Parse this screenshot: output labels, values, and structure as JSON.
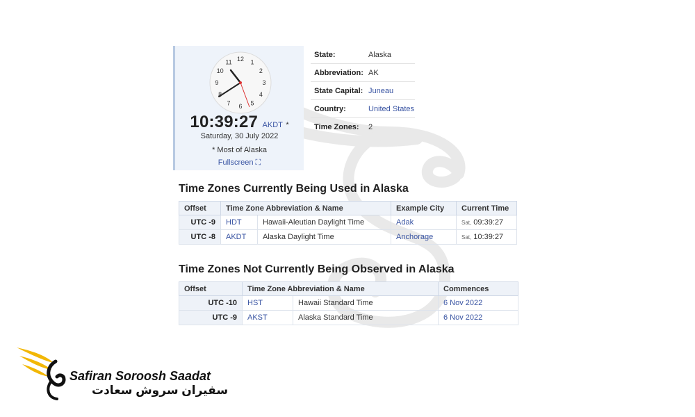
{
  "clock": {
    "numbers": [
      "12",
      "1",
      "2",
      "3",
      "4",
      "5",
      "6",
      "7",
      "8",
      "9",
      "10",
      "11"
    ],
    "time": "10:39:27",
    "tz": "AKDT",
    "star": "*",
    "date": "Saturday, 30 July 2022",
    "note": "* Most of Alaska",
    "fullscreen": "Fullscreen ⛶"
  },
  "info": [
    {
      "k": "State:",
      "v": "Alaska",
      "link": false
    },
    {
      "k": "Abbreviation:",
      "v": "AK",
      "link": false
    },
    {
      "k": "State Capital:",
      "v": "Juneau",
      "link": true
    },
    {
      "k": "Country:",
      "v": "United States",
      "link": true
    },
    {
      "k": "Time Zones:",
      "v": "2",
      "link": false
    }
  ],
  "used": {
    "heading": "Time Zones Currently Being Used in Alaska",
    "headers": [
      "Offset",
      "Time Zone Abbreviation & Name",
      "Example City",
      "Current Time"
    ],
    "rows": [
      {
        "offset": "UTC -9",
        "abbr": "HDT",
        "name": "Hawaii-Aleutian Daylight Time",
        "city": "Adak",
        "day": "Sat,",
        "time": "09:39:27"
      },
      {
        "offset": "UTC -8",
        "abbr": "AKDT",
        "name": "Alaska Daylight Time",
        "city": "Anchorage",
        "day": "Sat,",
        "time": "10:39:27"
      }
    ]
  },
  "notused": {
    "heading": "Time Zones Not Currently Being Observed in Alaska",
    "headers": [
      "Offset",
      "Time Zone Abbreviation & Name",
      "Commences"
    ],
    "rows": [
      {
        "offset": "UTC -10",
        "abbr": "HST",
        "name": "Hawaii Standard Time",
        "commences": "6 Nov 2022"
      },
      {
        "offset": "UTC -9",
        "abbr": "AKST",
        "name": "Alaska Standard Time",
        "commences": "6 Nov 2022"
      }
    ]
  },
  "logo": {
    "name_en": "Safiran Soroosh Saadat",
    "name_fa": "سفیران سروش سعادت",
    "wing_color": "#f2b705"
  }
}
